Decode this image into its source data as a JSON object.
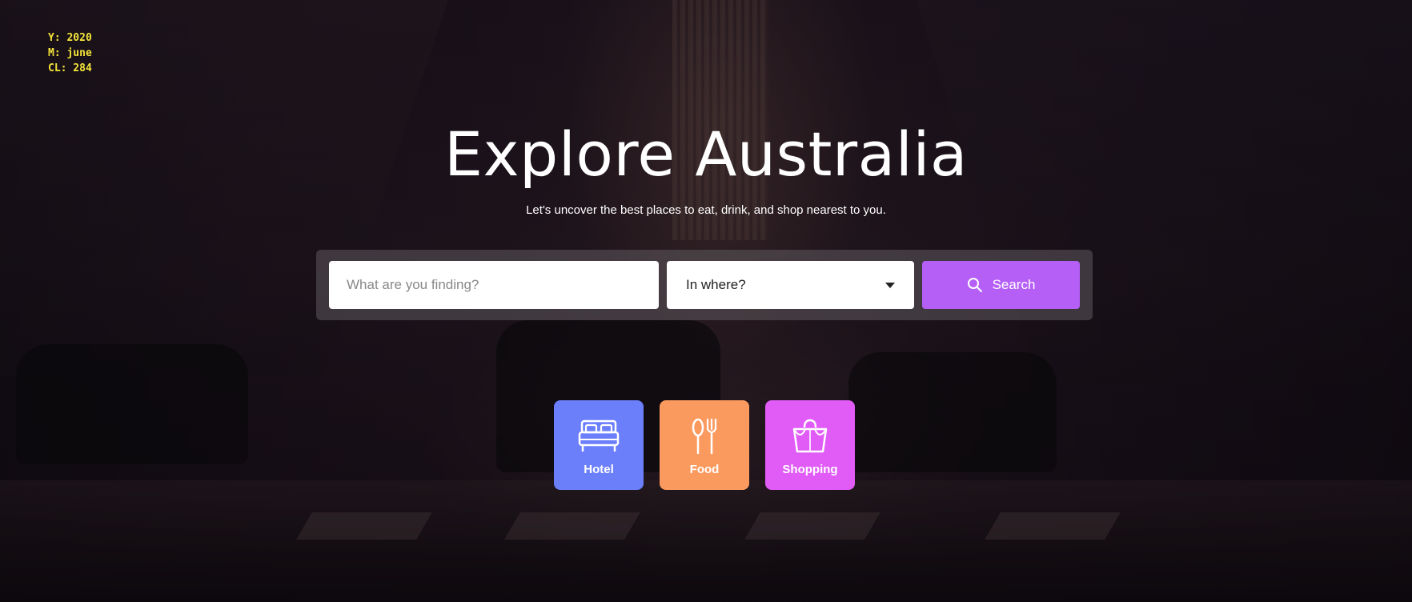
{
  "overlay": {
    "year": "Y: 2020",
    "month": "M: june",
    "cl": "CL: 284"
  },
  "hero": {
    "title": "Explore Australia",
    "subtitle": "Let's uncover the best places to eat, drink, and shop nearest to you."
  },
  "search": {
    "query_placeholder": "What are you finding?",
    "query_value": "",
    "location_selected": "In where?",
    "button_label": "Search",
    "button_color": "#b55ff6"
  },
  "categories": [
    {
      "label": "Hotel",
      "icon": "bed-icon",
      "color": "#6b7ffb"
    },
    {
      "label": "Food",
      "icon": "utensils-icon",
      "color": "#fb9a5f"
    },
    {
      "label": "Shopping",
      "icon": "shopping-bag-icon",
      "color": "#e15cf7"
    }
  ]
}
